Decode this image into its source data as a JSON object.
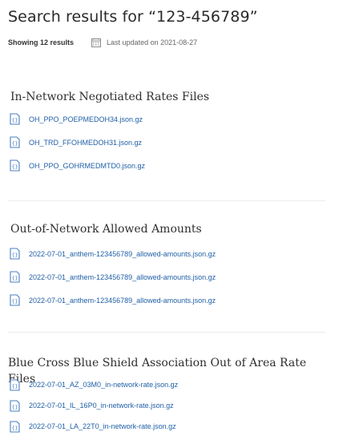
{
  "header": {
    "title": "Search results for “123-456789”",
    "results_count": "Showing 12 results",
    "last_updated": "Last updated on 2021-08-27",
    "calendar_icon": "calendar-icon"
  },
  "sections": [
    {
      "title": "In-Network Negotiated Rates Files",
      "files": [
        "OH_PPO_POEPMEDOH34.json.gz",
        "OH_TRD_FFOHMEDOH31.json.gz",
        "OH_PPO_GOHRMEDMTD0.json.gz"
      ]
    },
    {
      "title": "Out-of-Network Allowed Amounts",
      "files": [
        "2022-07-01_anthem-123456789_allowed-amounts.json.gz",
        "2022-07-01_anthem-123456789_allowed-amounts.json.gz",
        "2022-07-01_anthem-123456789_allowed-amounts.json.gz"
      ]
    },
    {
      "title": "Blue Cross Blue Shield Association Out of Area Rate Files",
      "files": [
        "2022-07-01_AZ_03M0_in-network-rate.json.gz",
        "2022-07-01_IL_16P0_in-network-rate.json.gz",
        "2022-07-01_LA_22T0_in-network-rate.json.gz"
      ]
    }
  ],
  "colors": {
    "link": "#1f5fa6",
    "icon_border": "#4a7fc1",
    "title_text": "#2a2a2a"
  },
  "file_icon": "json-file-icon"
}
